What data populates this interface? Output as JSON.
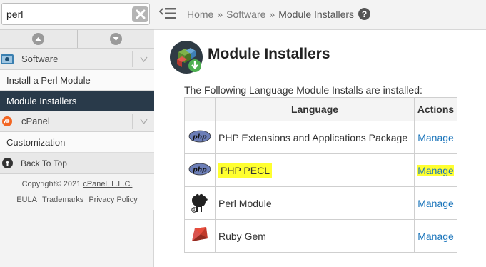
{
  "sidebar": {
    "search": {
      "value": "perl",
      "placeholder": ""
    },
    "categories": [
      {
        "label": "Software"
      },
      {
        "label": "cPanel"
      }
    ],
    "software_items": [
      "Install a Perl Module",
      "Module Installers"
    ],
    "cpanel_items": [
      "Customization"
    ],
    "back_to_top": "Back To Top",
    "footer": {
      "copyright_prefix": "Copyright© 2021",
      "copyright_link": "cPanel, L.L.C.",
      "links": [
        "EULA",
        "Trademarks",
        "Privacy Policy"
      ]
    }
  },
  "breadcrumb": {
    "home": "Home",
    "separator": "»",
    "section": "Software",
    "current": "Module Installers",
    "help": "?"
  },
  "page": {
    "title": "Module Installers",
    "intro": "The Following Language Module Installs are installed:"
  },
  "table": {
    "headers": {
      "language": "Language",
      "actions": "Actions"
    },
    "rows": [
      {
        "icon": "php-icon",
        "name": "PHP Extensions and Applications Package",
        "action": "Manage",
        "highlighted": false
      },
      {
        "icon": "php-icon",
        "name": "PHP PECL",
        "action": "Manage",
        "highlighted": true
      },
      {
        "icon": "perl-camel-icon",
        "name": "Perl Module",
        "action": "Manage",
        "highlighted": false
      },
      {
        "icon": "ruby-gem-icon",
        "name": "Ruby Gem",
        "action": "Manage",
        "highlighted": false
      }
    ]
  },
  "colors": {
    "sidebar_active_bg": "#293a4a",
    "link": "#1b75bb",
    "highlight": "#ffff30",
    "cpanel_orange": "#f26522"
  }
}
